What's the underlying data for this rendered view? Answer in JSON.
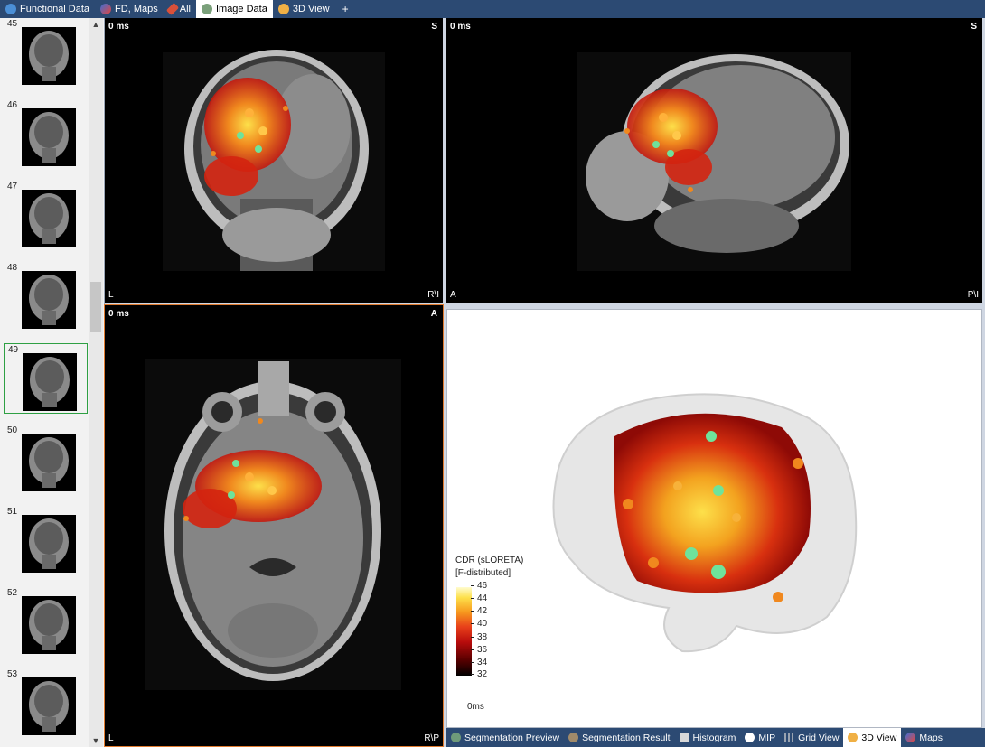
{
  "tabs": [
    {
      "label": "Functional Data",
      "icon": "waveform-icon",
      "active": false
    },
    {
      "label": "FD, Maps",
      "icon": "maps-icon",
      "active": false
    },
    {
      "label": "All",
      "icon": "brush-icon",
      "active": false
    },
    {
      "label": "Image Data",
      "icon": "head-icon",
      "active": true
    },
    {
      "label": "3D View",
      "icon": "head-3d-icon",
      "active": false
    }
  ],
  "add_tab_label": "+",
  "thumbnails": [
    {
      "number": "45"
    },
    {
      "number": "46"
    },
    {
      "number": "47"
    },
    {
      "number": "48"
    },
    {
      "number": "49",
      "selected": true
    },
    {
      "number": "50"
    },
    {
      "number": "51"
    },
    {
      "number": "52"
    },
    {
      "number": "53"
    }
  ],
  "scrollbar": {
    "up": "▲",
    "down": "▼"
  },
  "views": {
    "coronal": {
      "time": "0 ms",
      "top_right": "S",
      "bottom_left": "L",
      "bottom_right": "R\\I"
    },
    "sagittal": {
      "time": "0 ms",
      "top_right": "S",
      "bottom_left": "A",
      "bottom_right": "P\\I"
    },
    "axial": {
      "time": "0 ms",
      "top_right": "A",
      "bottom_left": "L",
      "bottom_right": "R\\P"
    }
  },
  "view3d": {
    "colorbar_title_1": "CDR (sLORETA)",
    "colorbar_title_2": "[F-distributed]",
    "ticks": [
      "46",
      "44",
      "42",
      "40",
      "38",
      "36",
      "34",
      "32"
    ],
    "time": "0ms"
  },
  "bottom_tabs": [
    {
      "label": "Segmentation Preview",
      "icon": "brain-icon",
      "active": false
    },
    {
      "label": "Segmentation Result",
      "icon": "brain-icon",
      "active": false
    },
    {
      "label": "Histogram",
      "icon": "histogram-icon",
      "active": false
    },
    {
      "label": "MIP",
      "icon": "mip-icon",
      "active": false
    },
    {
      "label": "Grid View",
      "icon": "grid-icon",
      "active": false
    },
    {
      "label": "3D View",
      "icon": "head-3d-icon",
      "active": true
    },
    {
      "label": "Maps",
      "icon": "maps-icon",
      "active": false
    }
  ],
  "colors": {
    "chrome": "#2c4a73",
    "active_view_border": "#e07a2e",
    "selected_thumb": "#2ea043"
  }
}
